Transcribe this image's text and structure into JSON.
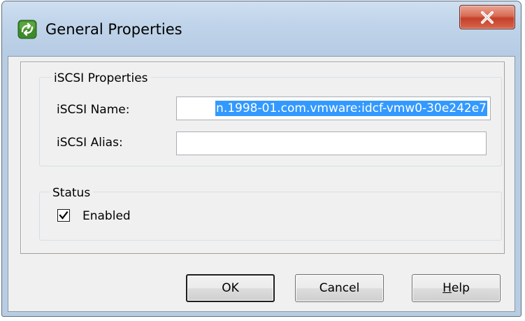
{
  "window": {
    "title": "General Properties",
    "icon": "vsphere-client-icon"
  },
  "properties_group": {
    "legend": "iSCSI Properties",
    "name_label": "iSCSI Name:",
    "name_value": "n.1998-01.com.vmware:idcf-vmw0-30e242e7",
    "alias_label": "iSCSI Alias:",
    "alias_value": ""
  },
  "status_group": {
    "legend": "Status",
    "enabled_label": "Enabled",
    "enabled_checked": true
  },
  "buttons": {
    "ok": "OK",
    "cancel": "Cancel",
    "help": "Help"
  },
  "colors": {
    "selection": "#3399ff",
    "close_button": "#c4402a",
    "app_icon": "#3d8a2a"
  }
}
